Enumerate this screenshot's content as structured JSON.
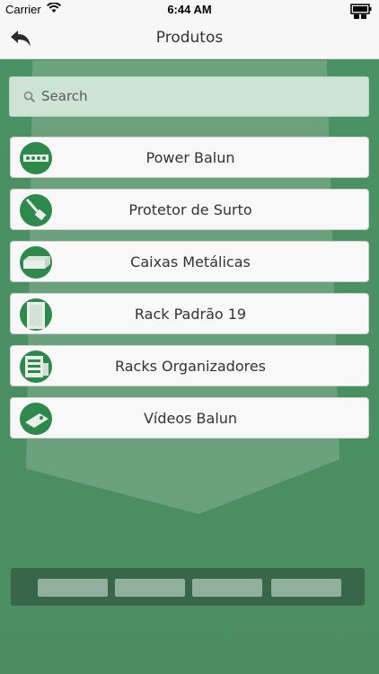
{
  "status_bar": {
    "carrier": "Carrier",
    "time": "6:44 AM"
  },
  "nav": {
    "title": "Produtos",
    "back_icon": "back-arrow-icon"
  },
  "search": {
    "placeholder": "Search",
    "icon": "search-icon"
  },
  "products": [
    {
      "label": "Power Balun",
      "icon": "power-balun-thumbnail"
    },
    {
      "label": "Protetor de Surto",
      "icon": "surge-protector-thumbnail"
    },
    {
      "label": "Caixas Metálicas",
      "icon": "metal-box-thumbnail"
    },
    {
      "label": "Rack Padrão 19",
      "icon": "rack-19-thumbnail"
    },
    {
      "label": "Racks Organizadores",
      "icon": "organizer-rack-thumbnail"
    },
    {
      "label": "Vídeos Balun",
      "icon": "video-balun-thumbnail"
    }
  ],
  "colors": {
    "background": "#4a8f62",
    "thumb": "#2d8a4c",
    "search_bg": "#cde4d4"
  }
}
